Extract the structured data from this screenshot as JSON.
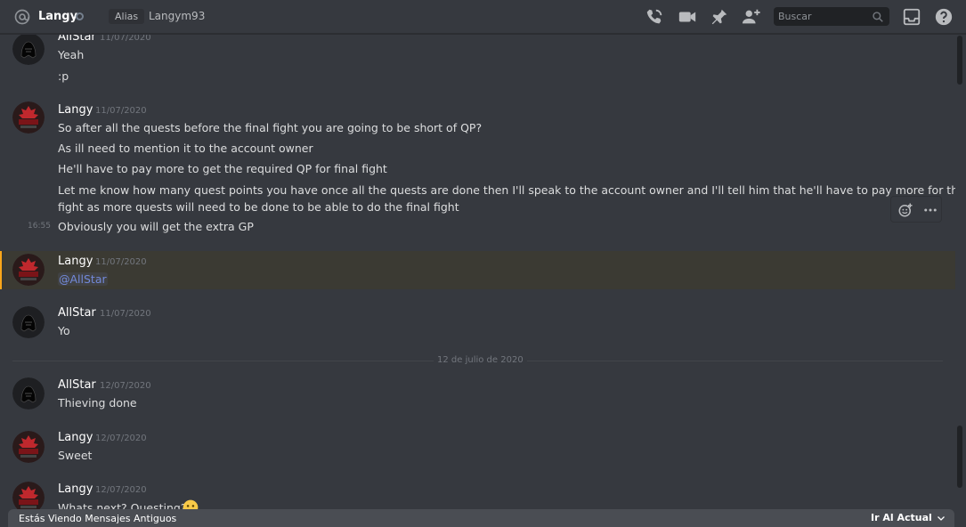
{
  "header": {
    "channel_name": "Langy",
    "alias_label": "Alias",
    "alias_value": "Langym93",
    "search_placeholder": "Buscar",
    "icons": [
      "at-icon",
      "status-icon",
      "voice-call-icon",
      "video-call-icon",
      "pin-icon",
      "add-member-icon",
      "search-icon",
      "inbox-icon",
      "help-icon"
    ]
  },
  "messages": [
    {
      "author": "AllStar",
      "date": "11/07/2020",
      "lines": [
        "Yeah",
        ":p"
      ]
    },
    {
      "author": "Langy",
      "date": "11/07/2020",
      "lines": [
        "So after all the quests before the final fight you are going to be short of QP?",
        "As ill need to mention it to the account owner",
        "He'll have to pay more to get the required QP for final fight",
        "Let me know how many quest points you have once all the quests are done then I'll speak to the account owner and I'll tell him that he'll have to pay more for the final",
        "fight as more quests will need to be done to be able to do the final fight",
        "Obviously you will get the extra GP"
      ],
      "hover_time": "16:55"
    },
    {
      "author": "Langy",
      "date": "11/07/2020",
      "lines": [
        "@AllStar"
      ]
    },
    {
      "author": "AllStar",
      "date": "11/07/2020",
      "lines": [
        "Yo"
      ]
    },
    {
      "author": "AllStar",
      "date": "12/07/2020",
      "lines": [
        "Thieving done"
      ]
    },
    {
      "author": "Langy",
      "date": "12/07/2020",
      "lines": [
        "Sweet"
      ]
    },
    {
      "author": "Langy",
      "date": "12/07/2020",
      "lines": [
        "Whats next? Questing?"
      ]
    }
  ],
  "divider": {
    "label": "12 de julio de 2020"
  },
  "footer": {
    "old_messages_label": "Estás Viendo Mensajes Antiguos",
    "jump_label": "Ir Al Actual"
  },
  "colors": {
    "background": "#36393f",
    "mention_highlight": "#faa61a",
    "mention_text": "#7289da",
    "status_idle": "#747f8d"
  }
}
